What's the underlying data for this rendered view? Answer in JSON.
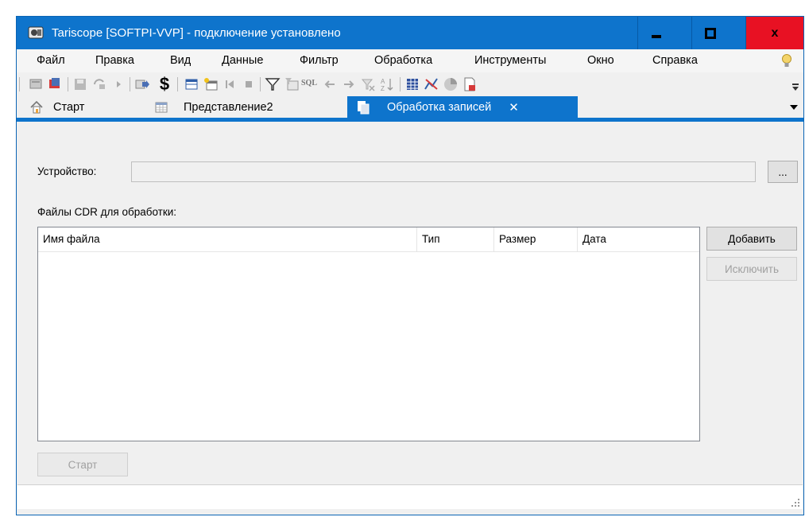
{
  "window": {
    "title": "Tariscope [SOFTPI-VVP] - подключение установлено",
    "accent": "#0e74cc",
    "close_color": "#e81123"
  },
  "title_controls": {
    "minimize": "▬",
    "maximize": "■",
    "close": "x"
  },
  "menu": [
    "Файл",
    "Правка",
    "Вид",
    "Данные",
    "Фильтр",
    "Обработка",
    "Инструменты",
    "Окно",
    "Справка"
  ],
  "toolbar": {
    "icons": [
      "query-icon",
      "query-edit-icon",
      "save-icon",
      "refresh-icon",
      "play-icon",
      "export-icon",
      "dollar-icon",
      "table-icon",
      "new-table-icon",
      "first-icon",
      "stop-icon",
      "filter-icon",
      "filter-table-icon",
      "sql-icon",
      "back-icon",
      "forward-icon",
      "clear-filter-icon",
      "sort-az-icon",
      "grid-icon",
      "chart-icon",
      "pie-icon",
      "report-icon"
    ],
    "sql_label": "SQL",
    "dollar_label": "$"
  },
  "tabs": [
    {
      "label": "Старт",
      "icon": "home-icon"
    },
    {
      "label": "Представление2",
      "icon": "table-icon"
    },
    {
      "label": "Обработка записей",
      "icon": "document-icon",
      "active": true,
      "close": "✕"
    }
  ],
  "tab_overflow": "▾",
  "form": {
    "device_label": "Устройство:",
    "device_value": "",
    "browse_label": "...",
    "files_label": "Файлы CDR для обработки:",
    "columns": [
      "Имя файла",
      "Тип",
      "Размер",
      "Дата"
    ],
    "rows": [],
    "add_button": "Добавить",
    "remove_button": "Исключить",
    "start_button": "Старт"
  },
  "status": {
    "text": ""
  }
}
